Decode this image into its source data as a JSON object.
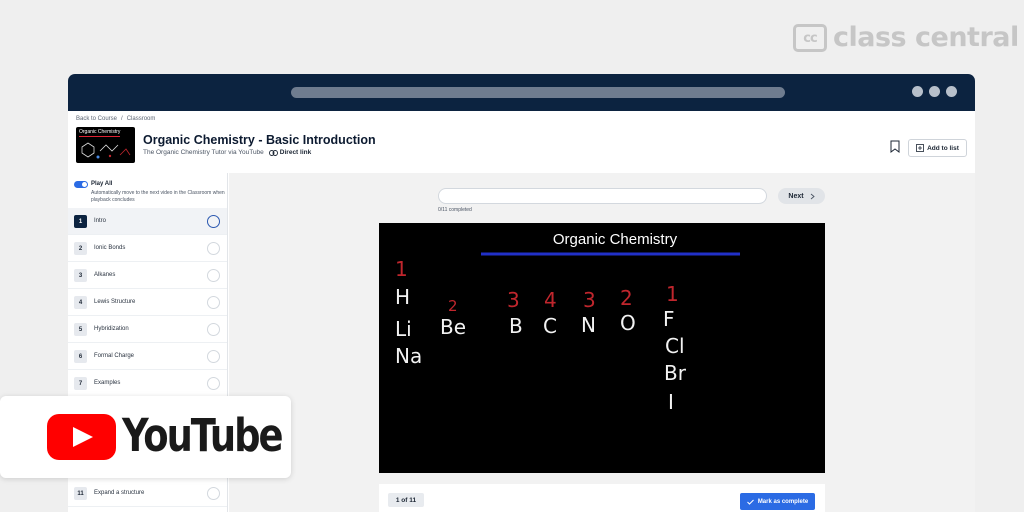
{
  "brand": {
    "logo_text": "cc",
    "name": "class central"
  },
  "header": {
    "breadcrumb": {
      "back": "Back to Course",
      "separator": "/",
      "current": "Classroom"
    },
    "thumbnail_title": "Organic Chemistry",
    "course_title": "Organic Chemistry - Basic Introduction",
    "subtitle": "The Organic Chemistry Tutor via YouTube",
    "direct_link": "Direct link",
    "add_to_list": "Add to list"
  },
  "sidebar": {
    "play_all_label": "Play All",
    "play_all_desc": "Automatically move to the next video in the Classroom when playback concludes",
    "lessons": [
      {
        "num": "1",
        "title": "Intro"
      },
      {
        "num": "2",
        "title": "Ionic Bonds"
      },
      {
        "num": "3",
        "title": "Alkanes"
      },
      {
        "num": "4",
        "title": "Lewis Structure"
      },
      {
        "num": "5",
        "title": "Hybridization"
      },
      {
        "num": "6",
        "title": "Formal Charge"
      },
      {
        "num": "7",
        "title": "Examples"
      },
      {
        "num": "11",
        "title": "Expand a structure"
      }
    ]
  },
  "main": {
    "progress_label": "0/11 completed",
    "next_label": "Next",
    "page_count": "1 of 11",
    "mark_complete": "Mark as complete"
  },
  "video": {
    "title": "Organic Chemistry",
    "numbers": [
      "1",
      "2",
      "3",
      "4",
      "3",
      "2",
      "1"
    ],
    "elements": [
      "H",
      "Li",
      "Na",
      "Be",
      "B",
      "C",
      "N",
      "O",
      "F",
      "Cl",
      "Br",
      "I"
    ]
  },
  "youtube": {
    "wordmark": "YouTube"
  },
  "colors": {
    "navy": "#0c2340",
    "accent": "#2b6be4",
    "youtube_red": "#ff0000",
    "chalk_red": "#c0262d"
  }
}
